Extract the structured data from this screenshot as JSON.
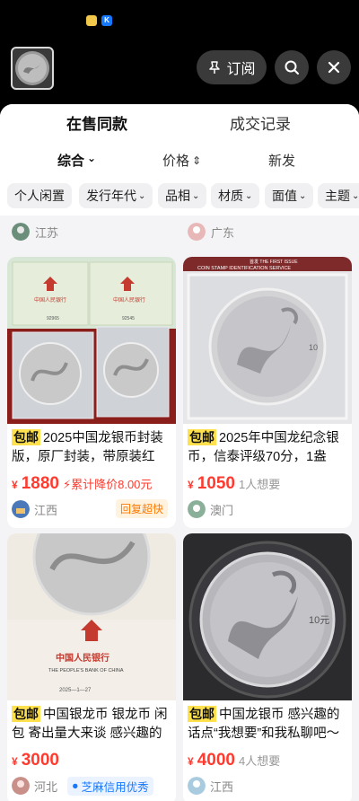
{
  "status": {
    "icon1": "weather-icon",
    "icon2": "app-k-icon",
    "icon2_text": "K"
  },
  "header": {
    "subscribe_label": "订阅"
  },
  "tabs": [
    {
      "label": "在售同款",
      "active": true
    },
    {
      "label": "成交记录",
      "active": false
    }
  ],
  "sort": [
    {
      "label": "综合",
      "arrow": "⌄"
    },
    {
      "label": "价格",
      "arrow": "⇕"
    },
    {
      "label": "新发",
      "arrow": ""
    }
  ],
  "filters": [
    "个人闲置",
    "发行年代",
    "品相",
    "材质",
    "面值",
    "主题"
  ],
  "prev_row": {
    "left_location": "江苏",
    "right_location": "广东"
  },
  "items": [
    {
      "badge": "包邮",
      "title": "2025中国龙银币封装版，原厂封装，带原装红",
      "currency": "¥",
      "price": "1880",
      "extra": "累计降价8.00元",
      "location": "江西",
      "tag": "回复超快"
    },
    {
      "badge": "包邮",
      "title": "2025年中国龙纪念银币，信泰评级70分，1盎",
      "currency": "¥",
      "price": "1050",
      "extra": "1人想要",
      "location": "澳门",
      "tag": ""
    },
    {
      "badge": "包邮",
      "title": "中国银龙币 银龙币 闲包 寄出量大来谈 感兴趣的",
      "currency": "¥",
      "price": "3000",
      "extra": "",
      "location": "河北",
      "tag": "芝麻信用优秀"
    },
    {
      "badge": "包邮",
      "title": "中国龙银币 感兴趣的话点“我想要”和我私聊吧～",
      "currency": "¥",
      "price": "4000",
      "extra": "4人想要",
      "location": "江西",
      "tag": ""
    }
  ],
  "image_text": {
    "bank_name": "中国人民银行",
    "bank_en": "THE PEOPLE'S BANK OF CHINA",
    "cert_no_1": "92965",
    "cert_no_2": "92545",
    "slab_label": "COIN STAMP IDENTIFICATION SERVICE",
    "slab_first": "首发 THE FIRST ISSUE",
    "date": "2025—1—27",
    "denom": "10元"
  },
  "colors": {
    "accent_yellow": "#ffe14d",
    "price_red": "#ff3b30",
    "credit_blue": "#1677ff"
  }
}
